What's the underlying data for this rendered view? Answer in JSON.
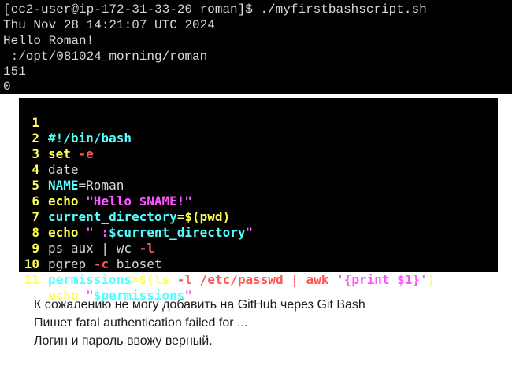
{
  "terminal": {
    "lines": [
      "[ec2-user@ip-172-31-33-20 roman]$ ./myfirstbashscript.sh",
      "Thu Nov 28 14:21:07 UTC 2024",
      "Hello Roman!",
      " :/opt/081024_morning/roman",
      "151",
      "0"
    ]
  },
  "editor": {
    "line_numbers": [
      "1",
      "2",
      "3",
      "4",
      "5",
      "6",
      "7",
      "8",
      "9",
      "10",
      "11"
    ],
    "l1": "#!/bin/bash",
    "l2_kw": "set",
    "l2_flag": "-e",
    "l3": "date",
    "l4_var": "NAME",
    "l4_val": "=Roman",
    "l5_kw": "echo",
    "l5_str": "\"Hello $NAME!\"",
    "l6_var": "current_directory",
    "l6_val": "=$(pwd)",
    "l7_kw": "echo",
    "l7_str_open": "\" :",
    "l7_var": "$current_directory",
    "l7_str_close": "\"",
    "l8_cmd": "ps aux | wc",
    "l8_flag": "-l",
    "l9_cmd": "pgrep",
    "l9_flag": "-c",
    "l9_arg": "bioset",
    "l10_var": "ermissions",
    "l10_cursor_char": "p",
    "l10_sub_open": "=$(ls",
    "l10_flag": "-l /etc/passwd | awk",
    "l10_str": "'{print $1}'",
    "l10_sub_close": ")",
    "l11_kw": "echo",
    "l11_str_open": "\"",
    "l11_var": "$permissions",
    "l11_str_close": "\""
  },
  "question": {
    "line1": "К сожалению не могу добавить на GitHub через Git Bash",
    "line2": "Пишет fatal authentication failed for ...",
    "line3": "Логин и пароль ввожу верный."
  },
  "colors": {
    "terminal_bg": "#000000",
    "terminal_text": "#d8d8d8",
    "comment": "#54ffff",
    "keyword": "#ffff54",
    "flag": "#ff5454",
    "string": "#ff54ff",
    "variable": "#54ffff"
  }
}
